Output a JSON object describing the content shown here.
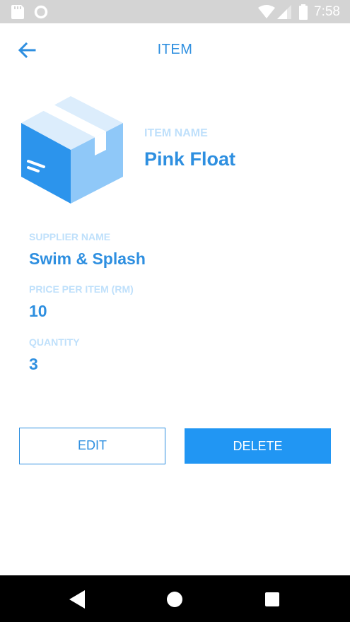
{
  "status_bar": {
    "time": "7:58",
    "icons": [
      "sd-card-icon",
      "circle-icon",
      "wifi-icon",
      "signal-icon",
      "battery-icon"
    ]
  },
  "app_bar": {
    "title": "ITEM",
    "back_icon": "arrow-left-icon"
  },
  "item": {
    "illustration_icon": "package-box-icon",
    "name_label": "ITEM NAME",
    "name_value": "Pink Float"
  },
  "fields": {
    "supplier": {
      "label": "SUPPLIER NAME",
      "value": "Swim & Splash"
    },
    "price": {
      "label": "PRICE PER ITEM (RM)",
      "value": "10"
    },
    "quantity": {
      "label": "QUANTITY",
      "value": "3"
    }
  },
  "actions": {
    "edit_label": "EDIT",
    "delete_label": "DELETE"
  },
  "nav_bar": {
    "icons": [
      "nav-back-icon",
      "nav-home-icon",
      "nav-recents-icon"
    ]
  },
  "colors": {
    "accent": "#2e8fe0",
    "delete_button": "#2196f3",
    "label_light": "#bfe0fb",
    "status_bar": "#d4d4d4",
    "nav_bar": "#000000"
  }
}
